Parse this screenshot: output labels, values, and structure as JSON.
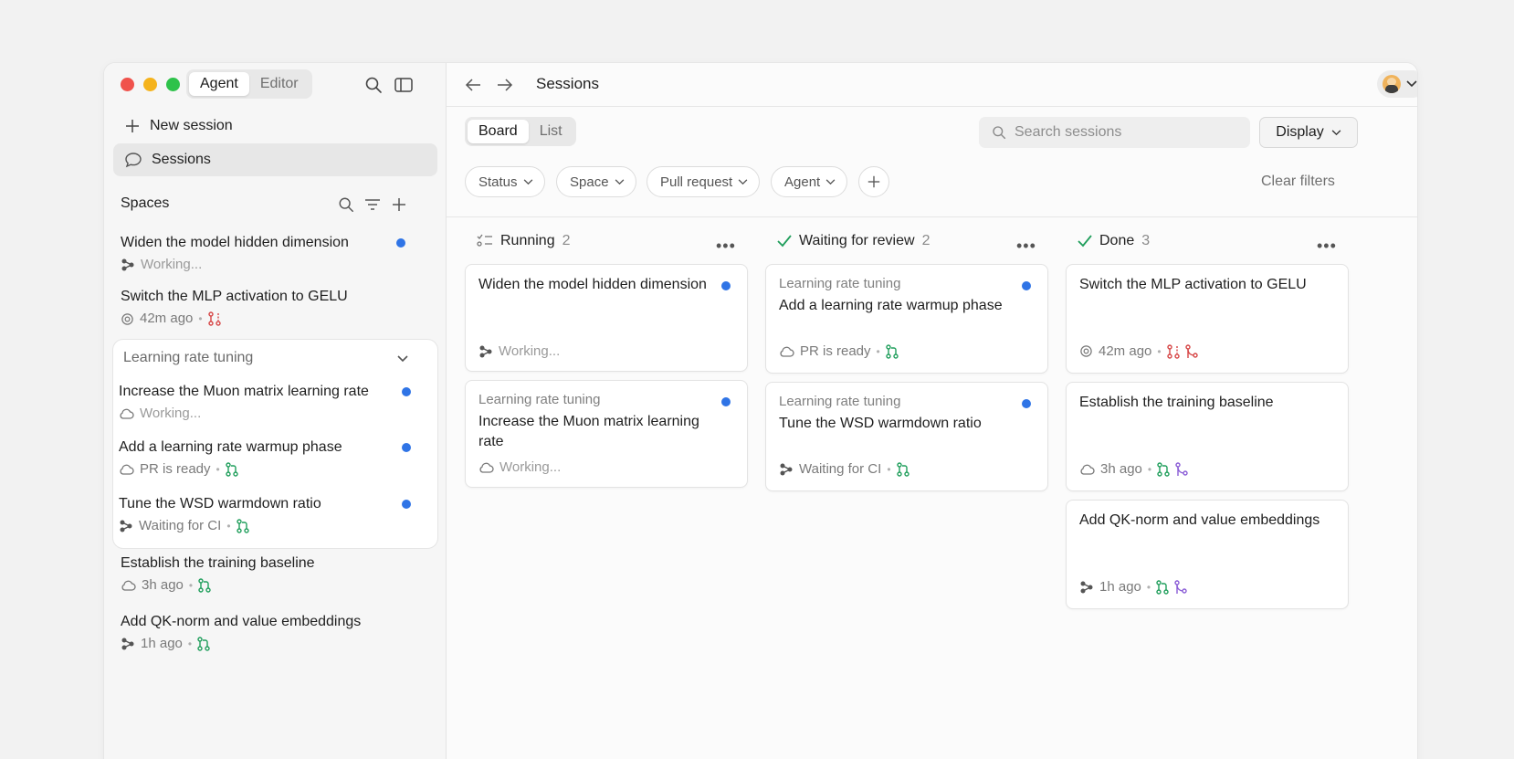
{
  "window": {
    "mode_tabs": [
      "Agent",
      "Editor"
    ],
    "active_mode": "Agent"
  },
  "sidebar": {
    "new_session": "New session",
    "sessions": "Sessions",
    "spaces_label": "Spaces",
    "items_top": [
      {
        "title": "Widen the model hidden dimension",
        "meta": "Working...",
        "dot": true
      },
      {
        "title": "Switch the MLP activation to GELU",
        "meta": "42m ago",
        "dot": false
      }
    ],
    "group": {
      "name": "Learning rate tuning",
      "items": [
        {
          "title": "Increase the Muon matrix learning rate",
          "meta": "Working...",
          "dot": true
        },
        {
          "title": "Add a learning rate warmup phase",
          "meta": "PR is ready",
          "dot": true
        },
        {
          "title": "Tune the WSD warmdown ratio",
          "meta": "Waiting for CI",
          "dot": true
        }
      ]
    },
    "items_bottom": [
      {
        "title": "Establish the training baseline",
        "meta": "3h ago"
      },
      {
        "title": "Add QK-norm and value embeddings",
        "meta": "1h ago"
      }
    ]
  },
  "header": {
    "title": "Sessions"
  },
  "toolbar": {
    "view_tabs": [
      "Board",
      "List"
    ],
    "active_view": "Board",
    "search_placeholder": "Search sessions",
    "display_label": "Display",
    "filters": [
      "Status",
      "Space",
      "Pull request",
      "Agent"
    ],
    "clear_filters": "Clear filters"
  },
  "board": {
    "columns": [
      {
        "name": "Running",
        "count": "2",
        "cards": [
          {
            "space": "",
            "title": "Widen the model hidden dimension",
            "meta": "Working...",
            "dot": true
          },
          {
            "space": "Learning rate tuning",
            "title": "Increase the Muon matrix learning rate",
            "meta": "Working...",
            "dot": true
          }
        ]
      },
      {
        "name": "Waiting for review",
        "count": "2",
        "cards": [
          {
            "space": "Learning rate tuning",
            "title": "Add a learning rate warmup phase",
            "meta": "PR is ready",
            "dot": true
          },
          {
            "space": "Learning rate tuning",
            "title": "Tune the WSD warmdown ratio",
            "meta": "Waiting for CI",
            "dot": true
          }
        ]
      },
      {
        "name": "Done",
        "count": "3",
        "cards": [
          {
            "space": "",
            "title": "Switch the MLP activation to GELU",
            "meta": "42m ago",
            "dot": false
          },
          {
            "space": "",
            "title": "Establish the training baseline",
            "meta": "3h ago",
            "dot": false
          },
          {
            "space": "",
            "title": "Add QK-norm and value embeddings",
            "meta": "1h ago",
            "dot": false
          }
        ]
      }
    ]
  },
  "colors": {
    "accent_blue": "#2f74e6",
    "pr_green": "#1f9e5b",
    "pr_red": "#d64545",
    "merge_purple": "#8a5cd6",
    "check_green": "#1f9e5b"
  }
}
